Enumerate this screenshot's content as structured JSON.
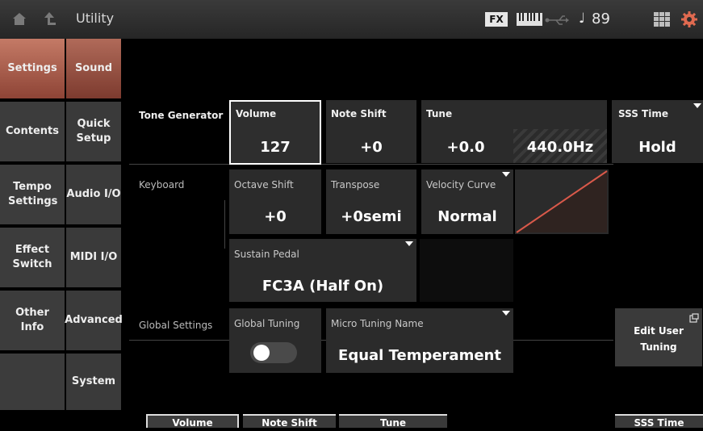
{
  "header": {
    "title": "Utility",
    "fx_label": "FX",
    "tempo_note": "♩",
    "tempo": "89"
  },
  "nav_primary": [
    {
      "label": "Settings",
      "active": true
    },
    {
      "label": "Contents",
      "active": false
    },
    {
      "label": "Tempo Settings",
      "active": false
    },
    {
      "label": "Effect Switch",
      "active": false
    },
    {
      "label": "Other Info",
      "active": false
    },
    {
      "label": "",
      "active": false
    }
  ],
  "nav_secondary": [
    {
      "label": "Sound",
      "active": true
    },
    {
      "label": "Quick Setup",
      "active": false
    },
    {
      "label": "Audio I/O",
      "active": false
    },
    {
      "label": "MIDI I/O",
      "active": false
    },
    {
      "label": "Advanced",
      "active": false
    },
    {
      "label": "System",
      "active": false
    }
  ],
  "tone_generator": {
    "section_label": "Tone Generator",
    "volume": {
      "label": "Volume",
      "value": "127"
    },
    "note_shift": {
      "label": "Note Shift",
      "value": "+0"
    },
    "tune": {
      "label": "Tune",
      "value": "+0.0",
      "hz": "440.0Hz"
    },
    "sss_time": {
      "label": "SSS Time",
      "value": "Hold"
    }
  },
  "keyboard": {
    "section_label": "Keyboard",
    "octave_shift": {
      "label": "Octave Shift",
      "value": "+0"
    },
    "transpose": {
      "label": "Transpose",
      "value": "+0semi"
    },
    "velocity_curve": {
      "label": "Velocity Curve",
      "value": "Normal"
    },
    "sustain_pedal": {
      "label": "Sustain Pedal",
      "value": "FC3A (Half On)"
    }
  },
  "global_settings": {
    "section_label": "Global Settings",
    "global_tuning": {
      "label": "Global Tuning",
      "on": true
    },
    "micro_tuning": {
      "label": "Micro Tuning Name",
      "value": "Equal Temperament"
    },
    "edit_user_tuning": "Edit User Tuning"
  },
  "bottom_tabs": [
    "Volume",
    "Note Shift",
    "Tune",
    "SSS Time"
  ],
  "colors": {
    "accent": "#b96c5b",
    "selection_border": "#ffffff",
    "curve_line": "#d9594a"
  }
}
